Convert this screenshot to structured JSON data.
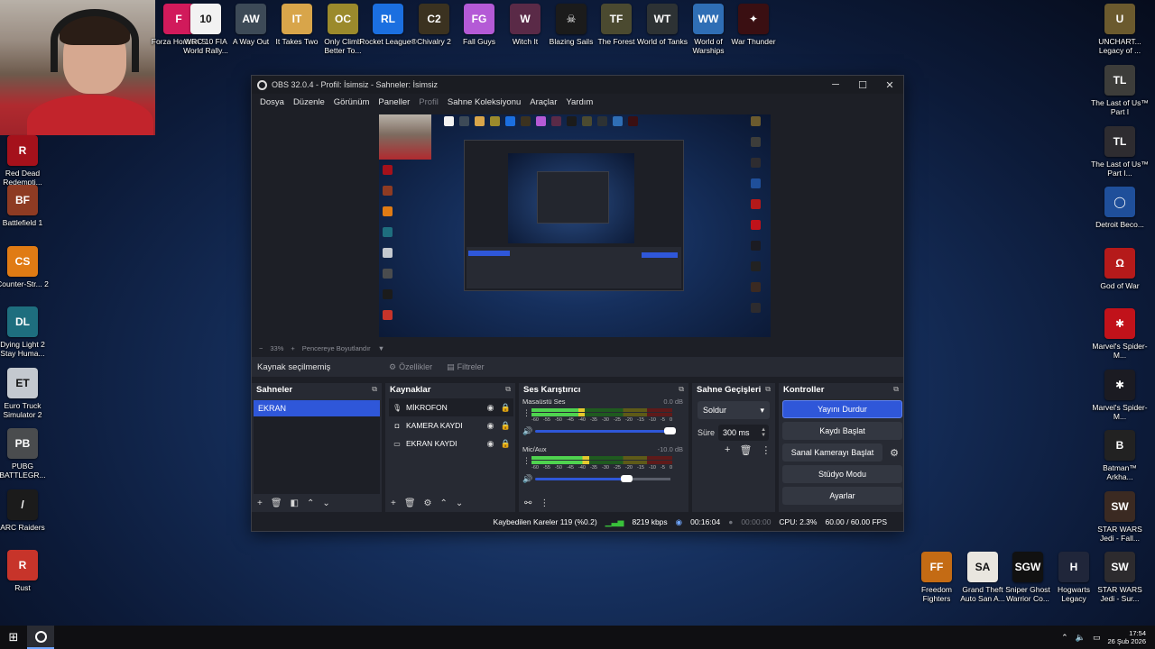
{
  "desktop": {
    "top_icons": [
      {
        "label": "Forza Horizon 5",
        "color": "#d11a5b",
        "glyph": "F",
        "display": "orza\nrizon 5"
      },
      {
        "label": "WRC 10 FIA World Rally...",
        "color": "#f2f2f2",
        "glyph": "10"
      },
      {
        "label": "A Way Out",
        "color": "#3d4a57",
        "glyph": "AW"
      },
      {
        "label": "It Takes Two",
        "color": "#d8a54a",
        "glyph": "IT"
      },
      {
        "label": "Only Climb Better To...",
        "color": "#9b8a2c",
        "glyph": "OC"
      },
      {
        "label": "Rocket League®",
        "color": "#1b6fe0",
        "glyph": "RL"
      },
      {
        "label": "Chivalry 2",
        "color": "#3b3220",
        "glyph": "C2"
      },
      {
        "label": "Fall Guys",
        "color": "#b45ad6",
        "glyph": "FG"
      },
      {
        "label": "Witch It",
        "color": "#5a2a47",
        "glyph": "W"
      },
      {
        "label": "Blazing Sails",
        "color": "#1b1b1b",
        "glyph": "☠"
      },
      {
        "label": "The Forest",
        "color": "#4b4a30",
        "glyph": "TF"
      },
      {
        "label": "World of Tanks",
        "color": "#2d3234",
        "glyph": "WT"
      },
      {
        "label": "World of Warships",
        "color": "#2f6eb5",
        "glyph": "WW"
      },
      {
        "label": "War Thunder",
        "color": "#3a0f12",
        "glyph": "✦"
      }
    ],
    "left_icons": [
      {
        "label": "Red Dead Redempti...",
        "color": "#a5111b",
        "glyph": "R"
      },
      {
        "label": "Battlefield 1",
        "color": "#8e3b23",
        "glyph": "BF"
      },
      {
        "label": "Counter-Str... 2",
        "color": "#e07b14",
        "glyph": "CS"
      },
      {
        "label": "Dying Light 2 Stay Huma...",
        "color": "#1e6e7e",
        "glyph": "DL"
      },
      {
        "label": "Euro Truck Simulator 2",
        "color": "#c4c9cf",
        "glyph": "ET"
      },
      {
        "label": "PUBG BATTLEGR...",
        "color": "#4a4c4e",
        "glyph": "PB"
      },
      {
        "label": "ARC Raiders",
        "color": "#1b1b1b",
        "glyph": "/"
      },
      {
        "label": "Rust",
        "color": "#c7342a",
        "glyph": "R"
      }
    ],
    "right_icons": [
      {
        "label": "UNCHART... Legacy of ...",
        "color": "#6b5a2e",
        "glyph": "U"
      },
      {
        "label": "The Last of Us™ Part I",
        "color": "#3d3d3a",
        "glyph": "TL"
      },
      {
        "label": "The Last of Us™ Part I...",
        "color": "#2e2c30",
        "glyph": "TL"
      },
      {
        "label": "Detroit Beco...",
        "color": "#1f4f9a",
        "glyph": "◯"
      },
      {
        "label": "God of War",
        "color": "#b51a1a",
        "glyph": "Ω"
      },
      {
        "label": "Marvel's Spider-M...",
        "color": "#c1121a",
        "glyph": "✱"
      },
      {
        "label": "Marvel's Spider-M...",
        "color": "#1b1b22",
        "glyph": "✱"
      },
      {
        "label": "Batman™ Arkha...",
        "color": "#222",
        "glyph": "B"
      },
      {
        "label": "STAR WARS Jedi - Fall...",
        "color": "#3b2a22",
        "glyph": "SW"
      },
      {
        "label": "STAR WARS Jedi - Sur...",
        "color": "#2d2b2e",
        "glyph": "SW"
      }
    ],
    "bottom_icons": [
      {
        "label": "Freedom Fighters",
        "color": "#c46b14",
        "glyph": "FF"
      },
      {
        "label": "Grand Theft Auto San A...",
        "color": "#e9e6df",
        "glyph": "SA"
      },
      {
        "label": "Sniper Ghost Warrior Co...",
        "color": "#111",
        "glyph": "SGW"
      },
      {
        "label": "Hogwarts Legacy",
        "color": "#20263a",
        "glyph": "H"
      },
      {
        "label": "STAR WARS Jedi - Sur...",
        "color": "#2d2b2e",
        "glyph": "SW"
      }
    ]
  },
  "obs": {
    "title": "OBS 32.0.4 - Profil: İsimsiz - Sahneler: İsimsiz",
    "menu": [
      "Dosya",
      "Düzenle",
      "Görünüm",
      "Paneller",
      "Profil",
      "Sahne Koleksiyonu",
      "Araçlar",
      "Yardım"
    ],
    "disabled_menu": "Profil",
    "preview_bar": {
      "zoom_minus": "−",
      "zoom": "33%",
      "zoom_plus": "+",
      "resize": "Pencereye Boyutlandır"
    },
    "no_source": "Kaynak seçilmemiş",
    "properties_label": "Özellikler",
    "filters_label": "Filtreler",
    "scenes": {
      "title": "Sahneler",
      "items": [
        "EKRAN"
      ]
    },
    "sources": {
      "title": "Kaynaklar",
      "items": [
        {
          "name": "MİKROFON",
          "icon": "microphone-icon"
        },
        {
          "name": "KAMERA KAYDI",
          "icon": "camera-icon"
        },
        {
          "name": "EKRAN KAYDI",
          "icon": "monitor-icon"
        }
      ]
    },
    "mixer": {
      "title": "Ses Karıştırıcı",
      "channels": [
        {
          "name": "Masaüstü Ses",
          "db": "0.0 dB",
          "level": 0.38,
          "volume": 1.0
        },
        {
          "name": "Mic/Aux",
          "db": "-10.0 dB",
          "level": 0.41,
          "volume": 0.68
        }
      ],
      "scale": [
        "-60",
        "-55",
        "-50",
        "-45",
        "-40",
        "-35",
        "-30",
        "-25",
        "-20",
        "-15",
        "-10",
        "-5",
        "0"
      ]
    },
    "transitions": {
      "title": "Sahne Geçişleri",
      "selected": "Soldur",
      "duration_label": "Süre",
      "duration": "300 ms"
    },
    "controls": {
      "title": "Kontroller",
      "stop_stream": "Yayını Durdur",
      "start_record": "Kaydı Başlat",
      "start_virtualcam": "Sanal Kamerayı Başlat",
      "studio_mode": "Stüdyo Modu",
      "settings": "Ayarlar"
    },
    "status": {
      "dropped": "Kaybedilen Kareler 119 (%0.2)",
      "bitrate": "8219 kbps",
      "stream_time": "00:16:04",
      "record_time": "00:00:00",
      "cpu": "CPU: 2.3%",
      "fps": "60.00 / 60.00 FPS"
    }
  },
  "taskbar": {
    "time": "17:54",
    "date": "26 Şub 2026"
  }
}
